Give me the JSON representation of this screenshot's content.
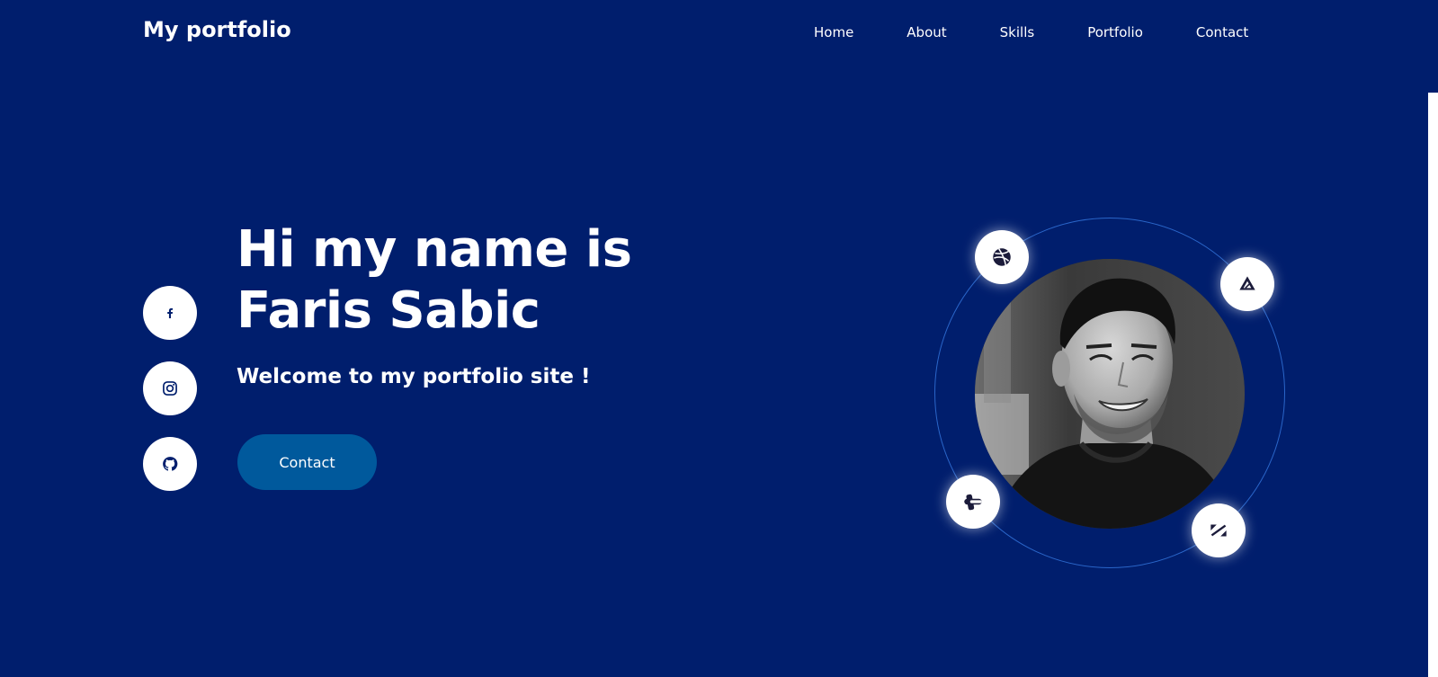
{
  "header": {
    "logo": "My portfolio",
    "nav": [
      "Home",
      "About",
      "Skills",
      "Portfolio",
      "Contact"
    ]
  },
  "social": [
    {
      "icon": "facebook-icon"
    },
    {
      "icon": "instagram-icon"
    },
    {
      "icon": "github-icon"
    }
  ],
  "hero": {
    "title_line1": "Hi my name is",
    "title_line2": "Faris Sabic",
    "subtitle": "Welcome to my portfolio site !",
    "contact_label": "Contact"
  },
  "tools": [
    {
      "icon": "dribbble-icon"
    },
    {
      "icon": "affinity-designer-icon"
    },
    {
      "icon": "tool-icon"
    },
    {
      "icon": "photo-editor-icon"
    }
  ],
  "colors": {
    "background": "#001e6d",
    "button": "#00599c",
    "orbit": "#2a66c9",
    "icon": "#001e6d"
  }
}
